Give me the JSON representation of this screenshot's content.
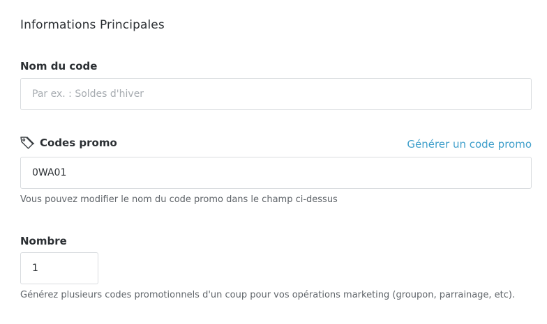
{
  "section": {
    "title": "Informations Principales"
  },
  "code_name": {
    "label": "Nom du code",
    "placeholder": "Par ex. : Soldes d'hiver",
    "value": ""
  },
  "promo_codes": {
    "label": "Codes promo",
    "icon": "tag-icon",
    "generate_link": "Générer un code promo",
    "value": "0WA01",
    "help": "Vous pouvez modifier le nom du code promo dans le champ ci-dessus"
  },
  "quantity": {
    "label": "Nombre",
    "value": "1",
    "help": "Générez plusieurs codes promotionnels d'un coup pour vos opérations marketing (groupon, parrainage, etc)."
  },
  "colors": {
    "link": "#3f9fcb",
    "text": "#2b2f33",
    "border": "#d9dcdf"
  }
}
